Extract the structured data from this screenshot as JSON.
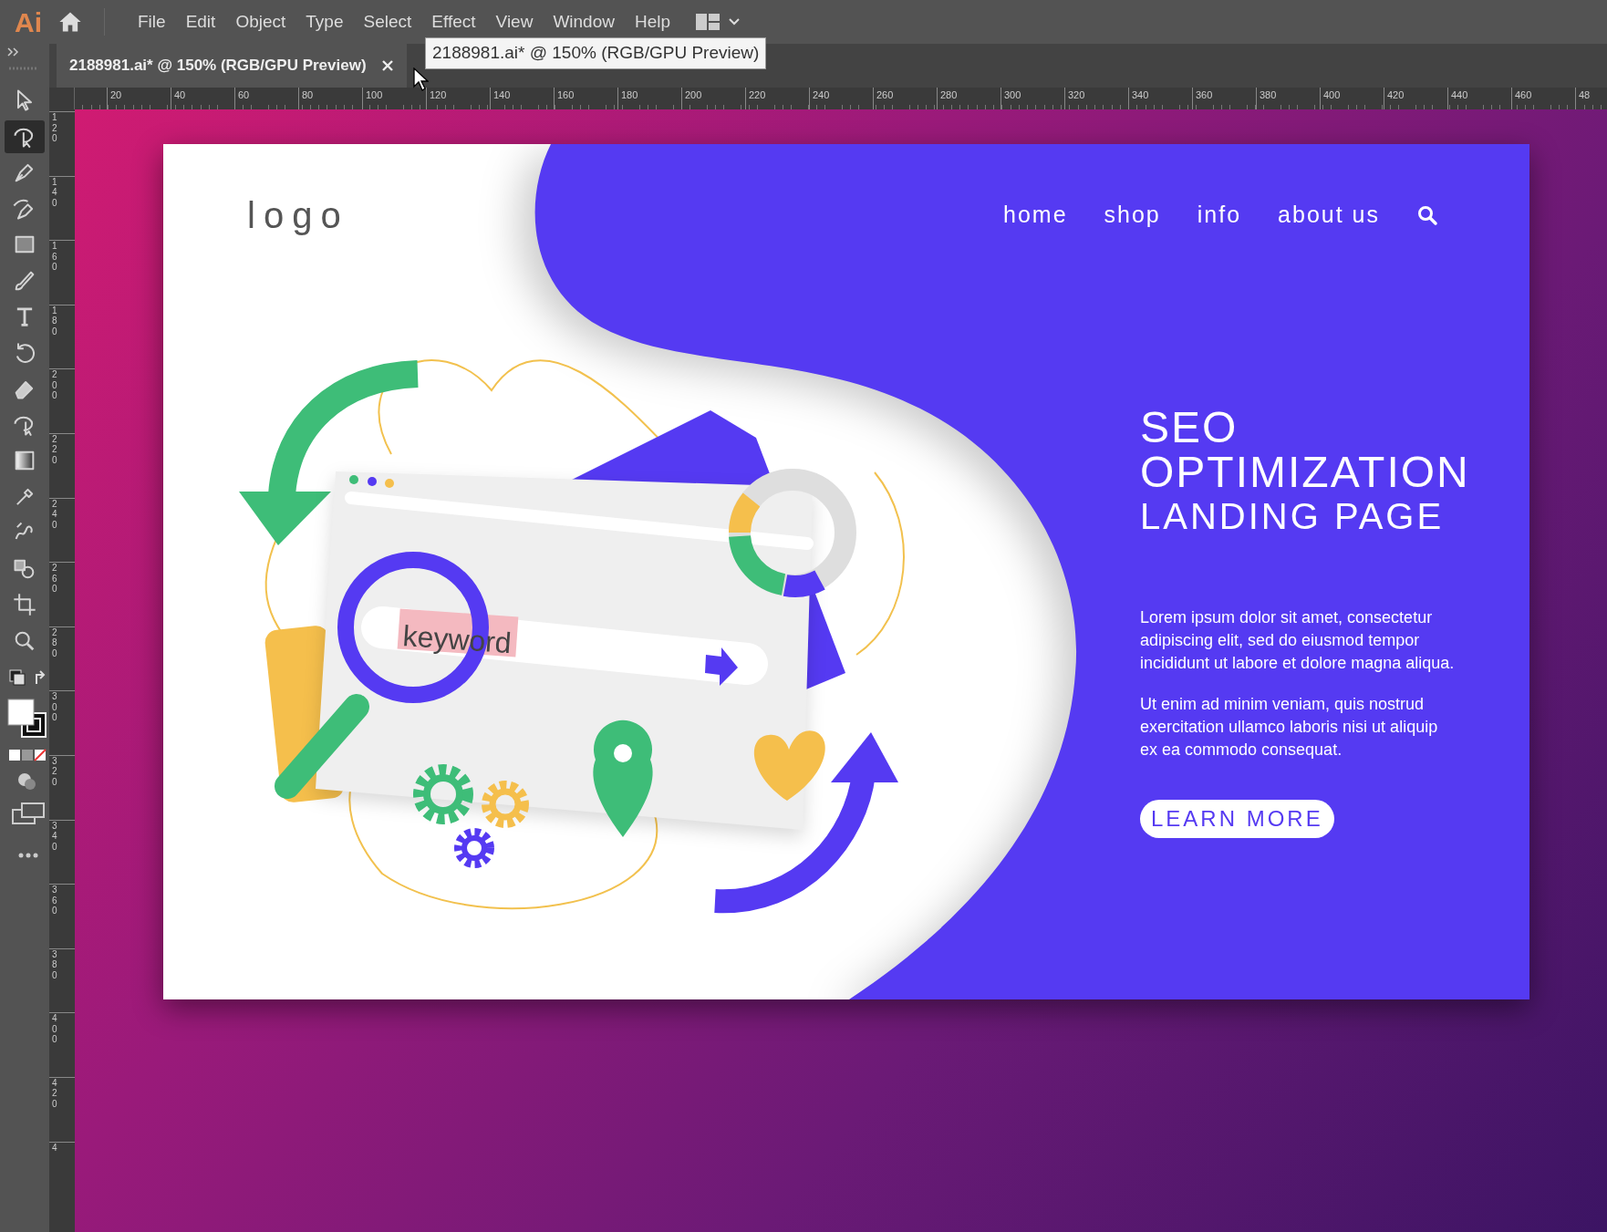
{
  "app_bar": {
    "logo": "Ai",
    "menu": [
      "File",
      "Edit",
      "Object",
      "Type",
      "Select",
      "Effect",
      "View",
      "Window",
      "Help"
    ]
  },
  "tooltip": "2188981.ai* @ 150% (RGB/GPU Preview)",
  "document_tab": {
    "title": "2188981.ai* @ 150% (RGB/GPU Preview)"
  },
  "tools": [
    {
      "kind": "select",
      "selected": false
    },
    {
      "kind": "shaper",
      "selected": true
    },
    {
      "kind": "pen",
      "selected": false
    },
    {
      "kind": "curvature",
      "selected": false
    },
    {
      "kind": "rectangle",
      "selected": false
    },
    {
      "kind": "brush",
      "selected": false
    },
    {
      "kind": "type",
      "selected": false
    },
    {
      "kind": "rotate",
      "selected": false
    },
    {
      "kind": "eraser",
      "selected": false
    },
    {
      "kind": "puppet",
      "selected": false
    },
    {
      "kind": "gradient",
      "selected": false
    },
    {
      "kind": "eyedropper",
      "selected": false
    },
    {
      "kind": "blend",
      "selected": false
    },
    {
      "kind": "shapebuilder",
      "selected": false
    },
    {
      "kind": "artboard",
      "selected": false
    },
    {
      "kind": "zoom",
      "selected": false
    }
  ],
  "horizontal_ruler": [
    "20",
    "40",
    "60",
    "80",
    "100",
    "120",
    "140",
    "160",
    "180",
    "200",
    "220",
    "240",
    "260",
    "280",
    "300",
    "320",
    "340",
    "360",
    "380",
    "400",
    "420",
    "440",
    "460",
    "48"
  ],
  "vertical_ruler": [
    "120",
    "140",
    "160",
    "180",
    "200",
    "220",
    "240",
    "260",
    "280",
    "300",
    "320",
    "340",
    "360",
    "380",
    "400",
    "420",
    "4"
  ],
  "artboard": {
    "logo": "logo",
    "nav": [
      "home",
      "shop",
      "info",
      "about us"
    ],
    "title": [
      "SEO",
      "OPTIMIZATION",
      "LANDING PAGE"
    ],
    "paragraphs": [
      "Lorem ipsum dolor sit amet, consectetur adipiscing elit, sed do eiusmod tempor incididunt ut labore et dolore magna aliqua.",
      "Ut enim ad minim veniam, quis nostrud exercitation ullamco laboris nisi ut aliquip ex ea commodo consequat."
    ],
    "button": "LEARN MORE",
    "illustration": {
      "keyword": "keyword"
    }
  }
}
